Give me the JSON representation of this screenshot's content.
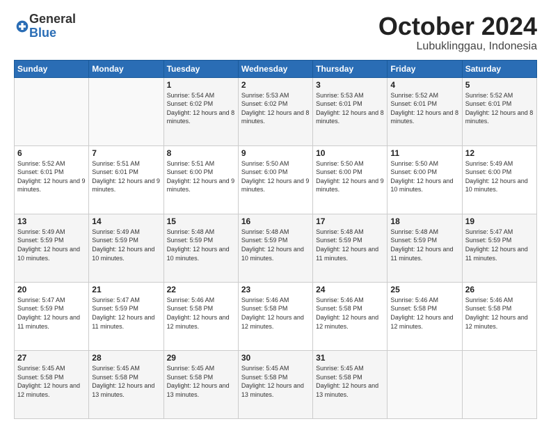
{
  "logo": {
    "general": "General",
    "blue": "Blue"
  },
  "header": {
    "title": "October 2024",
    "location": "Lubuklinggau, Indonesia"
  },
  "weekdays": [
    "Sunday",
    "Monday",
    "Tuesday",
    "Wednesday",
    "Thursday",
    "Friday",
    "Saturday"
  ],
  "weeks": [
    [
      {
        "day": "",
        "sunrise": "",
        "sunset": "",
        "daylight": ""
      },
      {
        "day": "",
        "sunrise": "",
        "sunset": "",
        "daylight": ""
      },
      {
        "day": "1",
        "sunrise": "Sunrise: 5:54 AM",
        "sunset": "Sunset: 6:02 PM",
        "daylight": "Daylight: 12 hours and 8 minutes."
      },
      {
        "day": "2",
        "sunrise": "Sunrise: 5:53 AM",
        "sunset": "Sunset: 6:02 PM",
        "daylight": "Daylight: 12 hours and 8 minutes."
      },
      {
        "day": "3",
        "sunrise": "Sunrise: 5:53 AM",
        "sunset": "Sunset: 6:01 PM",
        "daylight": "Daylight: 12 hours and 8 minutes."
      },
      {
        "day": "4",
        "sunrise": "Sunrise: 5:52 AM",
        "sunset": "Sunset: 6:01 PM",
        "daylight": "Daylight: 12 hours and 8 minutes."
      },
      {
        "day": "5",
        "sunrise": "Sunrise: 5:52 AM",
        "sunset": "Sunset: 6:01 PM",
        "daylight": "Daylight: 12 hours and 8 minutes."
      }
    ],
    [
      {
        "day": "6",
        "sunrise": "Sunrise: 5:52 AM",
        "sunset": "Sunset: 6:01 PM",
        "daylight": "Daylight: 12 hours and 9 minutes."
      },
      {
        "day": "7",
        "sunrise": "Sunrise: 5:51 AM",
        "sunset": "Sunset: 6:01 PM",
        "daylight": "Daylight: 12 hours and 9 minutes."
      },
      {
        "day": "8",
        "sunrise": "Sunrise: 5:51 AM",
        "sunset": "Sunset: 6:00 PM",
        "daylight": "Daylight: 12 hours and 9 minutes."
      },
      {
        "day": "9",
        "sunrise": "Sunrise: 5:50 AM",
        "sunset": "Sunset: 6:00 PM",
        "daylight": "Daylight: 12 hours and 9 minutes."
      },
      {
        "day": "10",
        "sunrise": "Sunrise: 5:50 AM",
        "sunset": "Sunset: 6:00 PM",
        "daylight": "Daylight: 12 hours and 9 minutes."
      },
      {
        "day": "11",
        "sunrise": "Sunrise: 5:50 AM",
        "sunset": "Sunset: 6:00 PM",
        "daylight": "Daylight: 12 hours and 10 minutes."
      },
      {
        "day": "12",
        "sunrise": "Sunrise: 5:49 AM",
        "sunset": "Sunset: 6:00 PM",
        "daylight": "Daylight: 12 hours and 10 minutes."
      }
    ],
    [
      {
        "day": "13",
        "sunrise": "Sunrise: 5:49 AM",
        "sunset": "Sunset: 5:59 PM",
        "daylight": "Daylight: 12 hours and 10 minutes."
      },
      {
        "day": "14",
        "sunrise": "Sunrise: 5:49 AM",
        "sunset": "Sunset: 5:59 PM",
        "daylight": "Daylight: 12 hours and 10 minutes."
      },
      {
        "day": "15",
        "sunrise": "Sunrise: 5:48 AM",
        "sunset": "Sunset: 5:59 PM",
        "daylight": "Daylight: 12 hours and 10 minutes."
      },
      {
        "day": "16",
        "sunrise": "Sunrise: 5:48 AM",
        "sunset": "Sunset: 5:59 PM",
        "daylight": "Daylight: 12 hours and 10 minutes."
      },
      {
        "day": "17",
        "sunrise": "Sunrise: 5:48 AM",
        "sunset": "Sunset: 5:59 PM",
        "daylight": "Daylight: 12 hours and 11 minutes."
      },
      {
        "day": "18",
        "sunrise": "Sunrise: 5:48 AM",
        "sunset": "Sunset: 5:59 PM",
        "daylight": "Daylight: 12 hours and 11 minutes."
      },
      {
        "day": "19",
        "sunrise": "Sunrise: 5:47 AM",
        "sunset": "Sunset: 5:59 PM",
        "daylight": "Daylight: 12 hours and 11 minutes."
      }
    ],
    [
      {
        "day": "20",
        "sunrise": "Sunrise: 5:47 AM",
        "sunset": "Sunset: 5:59 PM",
        "daylight": "Daylight: 12 hours and 11 minutes."
      },
      {
        "day": "21",
        "sunrise": "Sunrise: 5:47 AM",
        "sunset": "Sunset: 5:59 PM",
        "daylight": "Daylight: 12 hours and 11 minutes."
      },
      {
        "day": "22",
        "sunrise": "Sunrise: 5:46 AM",
        "sunset": "Sunset: 5:58 PM",
        "daylight": "Daylight: 12 hours and 12 minutes."
      },
      {
        "day": "23",
        "sunrise": "Sunrise: 5:46 AM",
        "sunset": "Sunset: 5:58 PM",
        "daylight": "Daylight: 12 hours and 12 minutes."
      },
      {
        "day": "24",
        "sunrise": "Sunrise: 5:46 AM",
        "sunset": "Sunset: 5:58 PM",
        "daylight": "Daylight: 12 hours and 12 minutes."
      },
      {
        "day": "25",
        "sunrise": "Sunrise: 5:46 AM",
        "sunset": "Sunset: 5:58 PM",
        "daylight": "Daylight: 12 hours and 12 minutes."
      },
      {
        "day": "26",
        "sunrise": "Sunrise: 5:46 AM",
        "sunset": "Sunset: 5:58 PM",
        "daylight": "Daylight: 12 hours and 12 minutes."
      }
    ],
    [
      {
        "day": "27",
        "sunrise": "Sunrise: 5:45 AM",
        "sunset": "Sunset: 5:58 PM",
        "daylight": "Daylight: 12 hours and 12 minutes."
      },
      {
        "day": "28",
        "sunrise": "Sunrise: 5:45 AM",
        "sunset": "Sunset: 5:58 PM",
        "daylight": "Daylight: 12 hours and 13 minutes."
      },
      {
        "day": "29",
        "sunrise": "Sunrise: 5:45 AM",
        "sunset": "Sunset: 5:58 PM",
        "daylight": "Daylight: 12 hours and 13 minutes."
      },
      {
        "day": "30",
        "sunrise": "Sunrise: 5:45 AM",
        "sunset": "Sunset: 5:58 PM",
        "daylight": "Daylight: 12 hours and 13 minutes."
      },
      {
        "day": "31",
        "sunrise": "Sunrise: 5:45 AM",
        "sunset": "Sunset: 5:58 PM",
        "daylight": "Daylight: 12 hours and 13 minutes."
      },
      {
        "day": "",
        "sunrise": "",
        "sunset": "",
        "daylight": ""
      },
      {
        "day": "",
        "sunrise": "",
        "sunset": "",
        "daylight": ""
      }
    ]
  ]
}
